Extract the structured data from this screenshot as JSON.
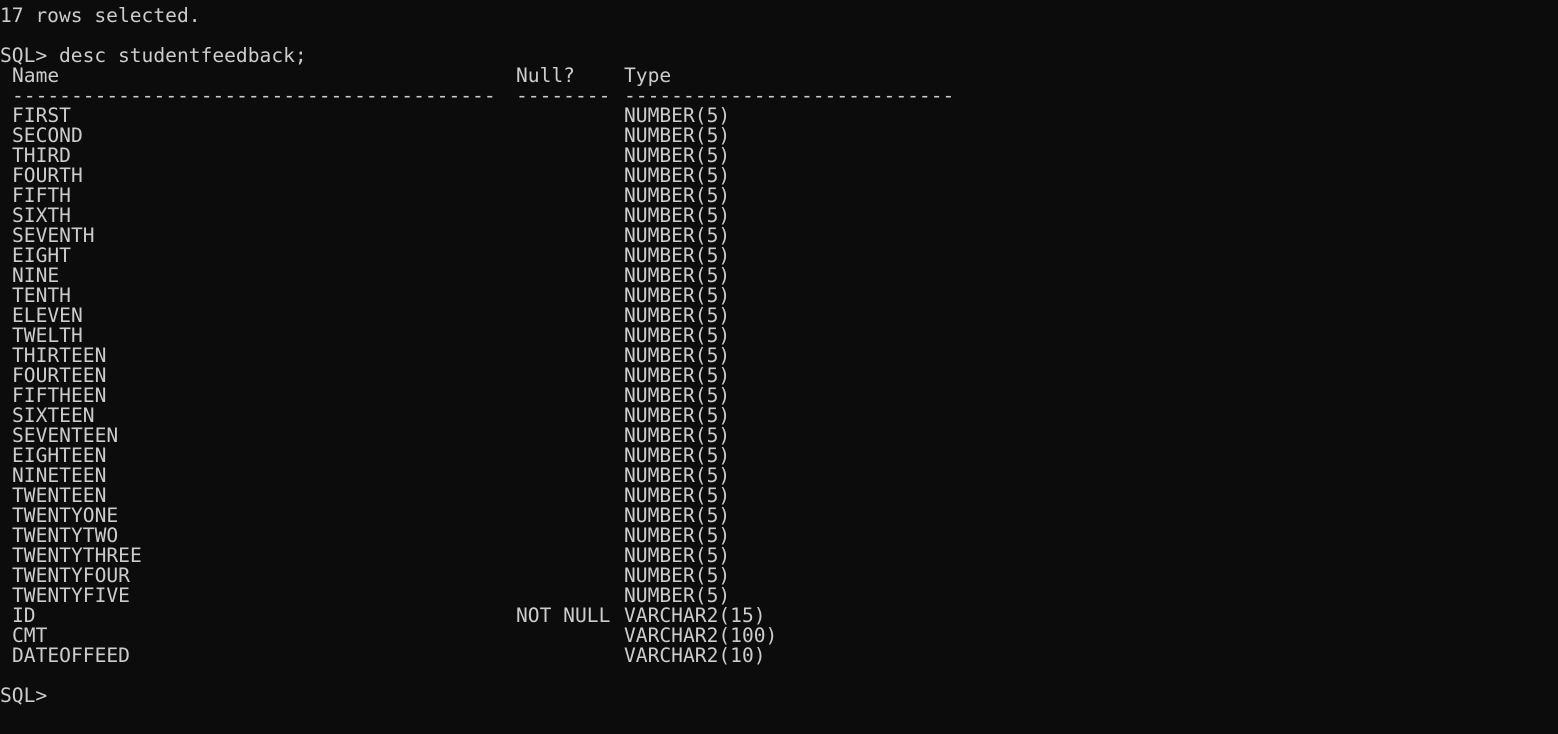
{
  "terminal": {
    "status_line": "17 rows selected.",
    "command_line": "SQL> desc studentfeedback;",
    "prompt": "SQL>",
    "headers": {
      "name": "Name",
      "null": "Null?",
      "type": "Type"
    },
    "separators": {
      "name": "-----------------------------------------",
      "null": "--------",
      "type": "----------------------------"
    },
    "rows": [
      {
        "name": "FIRST",
        "null": "",
        "type": "NUMBER(5)"
      },
      {
        "name": "SECOND",
        "null": "",
        "type": "NUMBER(5)"
      },
      {
        "name": "THIRD",
        "null": "",
        "type": "NUMBER(5)"
      },
      {
        "name": "FOURTH",
        "null": "",
        "type": "NUMBER(5)"
      },
      {
        "name": "FIFTH",
        "null": "",
        "type": "NUMBER(5)"
      },
      {
        "name": "SIXTH",
        "null": "",
        "type": "NUMBER(5)"
      },
      {
        "name": "SEVENTH",
        "null": "",
        "type": "NUMBER(5)"
      },
      {
        "name": "EIGHT",
        "null": "",
        "type": "NUMBER(5)"
      },
      {
        "name": "NINE",
        "null": "",
        "type": "NUMBER(5)"
      },
      {
        "name": "TENTH",
        "null": "",
        "type": "NUMBER(5)"
      },
      {
        "name": "ELEVEN",
        "null": "",
        "type": "NUMBER(5)"
      },
      {
        "name": "TWELTH",
        "null": "",
        "type": "NUMBER(5)"
      },
      {
        "name": "THIRTEEN",
        "null": "",
        "type": "NUMBER(5)"
      },
      {
        "name": "FOURTEEN",
        "null": "",
        "type": "NUMBER(5)"
      },
      {
        "name": "FIFTHEEN",
        "null": "",
        "type": "NUMBER(5)"
      },
      {
        "name": "SIXTEEN",
        "null": "",
        "type": "NUMBER(5)"
      },
      {
        "name": "SEVENTEEN",
        "null": "",
        "type": "NUMBER(5)"
      },
      {
        "name": "EIGHTEEN",
        "null": "",
        "type": "NUMBER(5)"
      },
      {
        "name": "NINETEEN",
        "null": "",
        "type": "NUMBER(5)"
      },
      {
        "name": "TWENTEEN",
        "null": "",
        "type": "NUMBER(5)"
      },
      {
        "name": "TWENTYONE",
        "null": "",
        "type": "NUMBER(5)"
      },
      {
        "name": "TWENTYTWO",
        "null": "",
        "type": "NUMBER(5)"
      },
      {
        "name": "TWENTYTHREE",
        "null": "",
        "type": "NUMBER(5)"
      },
      {
        "name": "TWENTYFOUR",
        "null": "",
        "type": "NUMBER(5)"
      },
      {
        "name": "TWENTYFIVE",
        "null": "",
        "type": "NUMBER(5)"
      },
      {
        "name": "ID",
        "null": "NOT NULL",
        "type": "VARCHAR2(15)"
      },
      {
        "name": "CMT",
        "null": "",
        "type": "VARCHAR2(100)"
      },
      {
        "name": "DATEOFFEED",
        "null": "",
        "type": "VARCHAR2(10)"
      }
    ]
  }
}
